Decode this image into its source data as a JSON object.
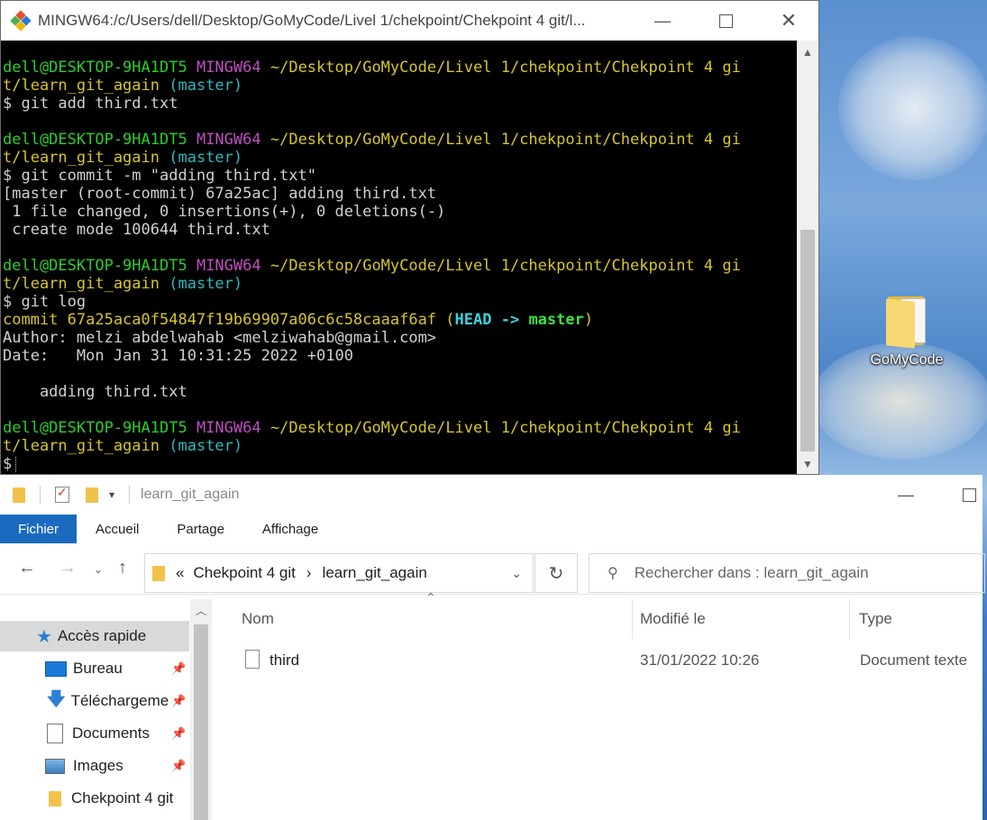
{
  "terminal": {
    "title": "MINGW64:/c/Users/dell/Desktop/GoMyCode/Livel 1/chekpoint/Chekpoint 4 git/l...",
    "prompt": {
      "user": "dell@DESKTOP-9HA1DT5",
      "env": "MINGW64",
      "path_line1": "~/Desktop/GoMyCode/Livel 1/chekpoint/Chekpoint 4 gi",
      "path_line2": "t/learn_git_again",
      "branch": "(master)"
    },
    "cmd1": "$ git add third.txt",
    "cmd2": "$ git commit -m \"adding third.txt\"",
    "out2_1": "[master (root-commit) 67a25ac] adding third.txt",
    "out2_2": " 1 file changed, 0 insertions(+), 0 deletions(-)",
    "out2_3": " create mode 100644 third.txt",
    "cmd3": "$ git log",
    "commit_label": "commit 67a25aca0f54847f19b69907a06c6c58caaaf6af",
    "commit_open": "(",
    "commit_head": "HEAD -> ",
    "commit_branch": "master",
    "commit_close": ")",
    "author": "Author: melzi abdelwahab <melziwahab@gmail.com>",
    "date": "Date:   Mon Jan 31 10:31:25 2022 +0100",
    "message": "    adding third.txt",
    "final_prompt": "$"
  },
  "desktop": {
    "folder_label": "GoMyCode"
  },
  "explorer": {
    "title": "learn_git_again",
    "ribbon": [
      "Fichier",
      "Accueil",
      "Partage",
      "Affichage"
    ],
    "address": {
      "overflow": "«",
      "crumb1": "Chekpoint 4 git",
      "sep": "›",
      "crumb2": "learn_git_again"
    },
    "search_placeholder": "Rechercher dans : learn_git_again",
    "sidebar": [
      {
        "label": "Accès rapide"
      },
      {
        "label": "Bureau"
      },
      {
        "label": "Téléchargeme"
      },
      {
        "label": "Documents"
      },
      {
        "label": "Images"
      },
      {
        "label": "Chekpoint 4 git"
      }
    ],
    "columns": {
      "name": "Nom",
      "modified": "Modifié le",
      "type": "Type"
    },
    "files": [
      {
        "name": "third",
        "modified": "31/01/2022 10:26",
        "type": "Document texte"
      }
    ]
  }
}
